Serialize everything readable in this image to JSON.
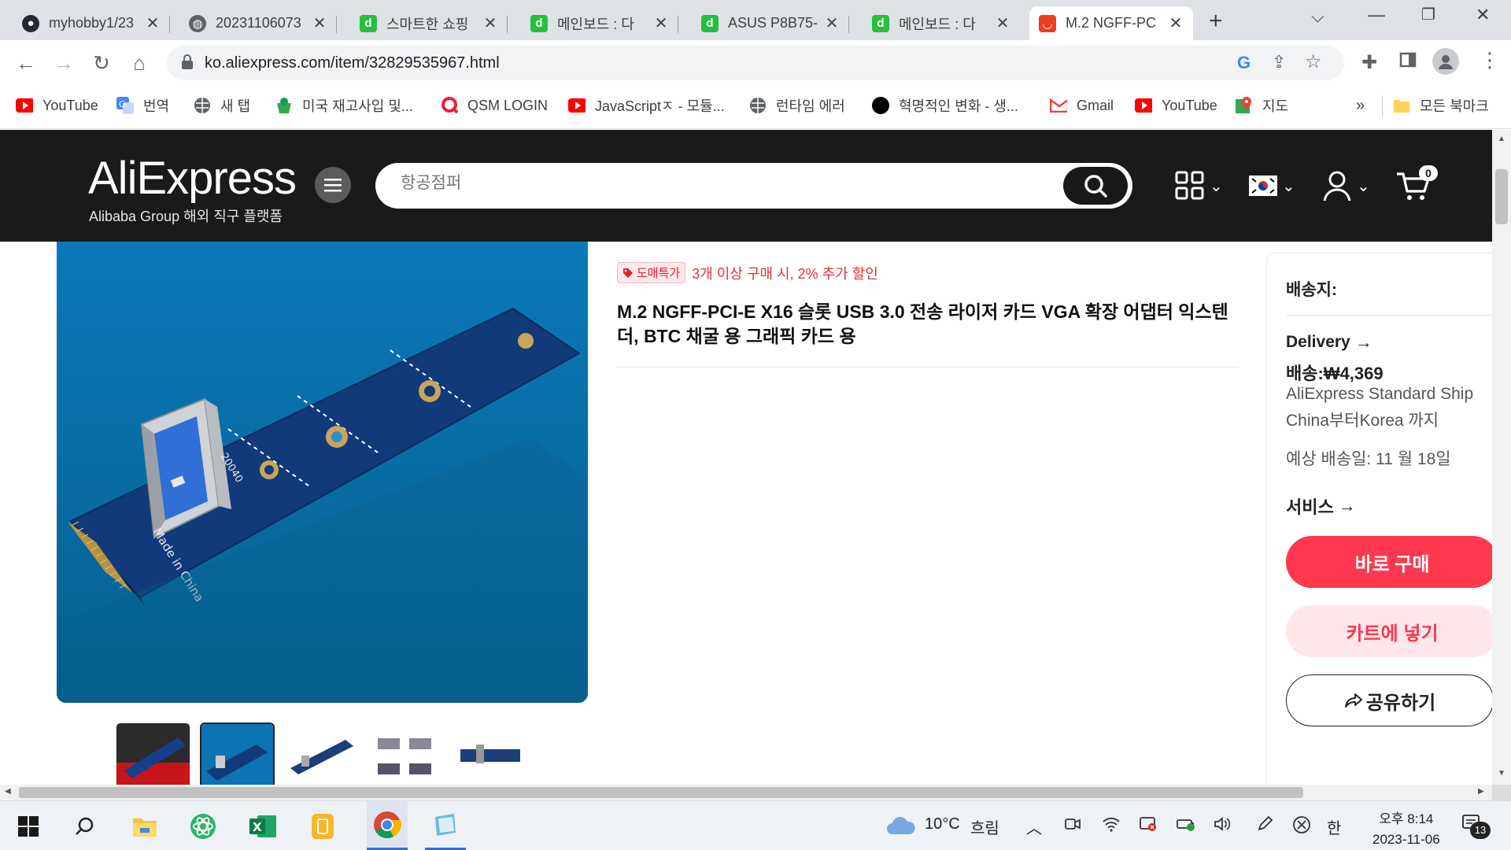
{
  "browser": {
    "tabs": [
      {
        "title": "myhobby1/23",
        "favicon": "github-icon",
        "color": "#24292f"
      },
      {
        "title": "20231106073",
        "favicon": "globe-icon",
        "color": "#5f6368"
      },
      {
        "title": "스마트한 쇼핑",
        "favicon": "d-icon",
        "color": "#25c13c"
      },
      {
        "title": "메인보드 : 다",
        "favicon": "d-icon",
        "color": "#25c13c"
      },
      {
        "title": "ASUS P8B75-",
        "favicon": "d-icon",
        "color": "#25c13c"
      },
      {
        "title": "메인보드 : 다",
        "favicon": "d-icon",
        "color": "#25c13c"
      },
      {
        "title": "M.2 NGFF-PC",
        "favicon": "aliexpress-icon",
        "color": "#ee3d23",
        "active": true
      }
    ],
    "url": "ko.aliexpress.com/item/32829535967.html",
    "bookmarks": [
      {
        "label": "YouTube",
        "icon": "youtube-icon"
      },
      {
        "label": "번역",
        "icon": "translate-icon"
      },
      {
        "label": "새 탭",
        "icon": "globe-icon"
      },
      {
        "label": "미국 재고사입 및...",
        "icon": "cup-icon"
      },
      {
        "label": "QSM LOGIN",
        "icon": "q-icon"
      },
      {
        "label": "JavaScriptㅈ - 모듈...",
        "icon": "youtube-icon"
      },
      {
        "label": "런타임 에러",
        "icon": "globe-icon"
      },
      {
        "label": "혁명적인 변화 - 생...",
        "icon": "circle-icon"
      },
      {
        "label": "Gmail",
        "icon": "gmail-icon"
      },
      {
        "label": "YouTube",
        "icon": "youtube-icon"
      },
      {
        "label": "지도",
        "icon": "maps-icon"
      }
    ],
    "bookmarks_more": "»",
    "all_bookmarks": "모든 북마크"
  },
  "site": {
    "logo": "AliExpress",
    "logo_sub": "Alibaba Group 해외 직구 플랫폼",
    "search_placeholder": "항공점퍼",
    "cart_count": "0"
  },
  "product": {
    "promo_badge": "도매특가",
    "promo_text": "3개 이상 구매 시, 2% 추가 할인",
    "title": "M.2 NGFF-PCI-E X16 슬롯 USB 3.0 전송 라이저 카드 VGA 확장 어댑터 익스텐더, BTC 채굴 용 그래픽 카드 용",
    "image_print_1": "Made in China",
    "image_print_2": "20040"
  },
  "sidebar": {
    "ship_to": "배송지:",
    "delivery": "Delivery",
    "shipping_price": "배송:₩4,369",
    "ship_method": "AliExpress Standard Ship",
    "ship_route": "China부터Korea 까지",
    "est_delivery": "예상 배송일: 11 월 18일",
    "services": "서비스",
    "buy_now": "바로 구매",
    "add_to_cart": "카트에 넣기",
    "share": "공유하기",
    "colors": {
      "buy": "#fd384f",
      "cart": "#ffe7e9",
      "cart_text": "#fd384f"
    }
  },
  "taskbar": {
    "weather_temp": "10°C",
    "weather_desc": "흐림",
    "ime": "한",
    "time": "오후 8:14",
    "date": "2023-11-06",
    "notif_count": "13"
  }
}
